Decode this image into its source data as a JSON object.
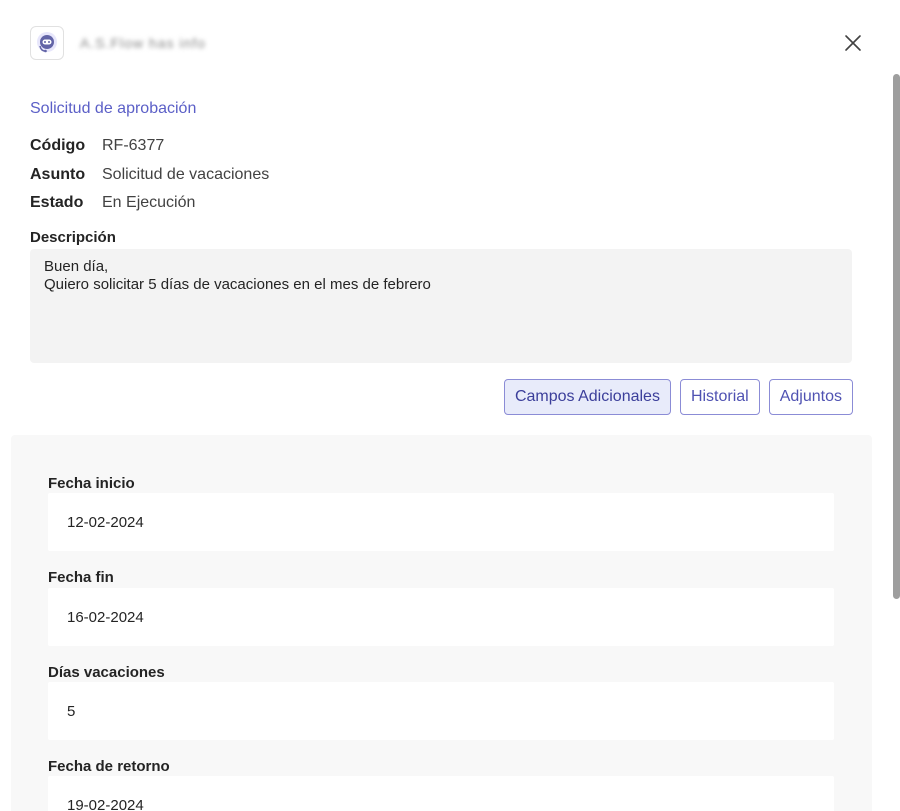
{
  "header": {
    "app_name": "A.S.Flow has info"
  },
  "request": {
    "title": "Solicitud de aprobación",
    "fields": [
      {
        "label": "Código",
        "value": "RF-6377"
      },
      {
        "label": "Asunto",
        "value": "Solicitud de vacaciones"
      },
      {
        "label": "Estado",
        "value": "En Ejecución"
      }
    ],
    "description_label": "Descripción",
    "description_lines": [
      "Buen día,",
      "Quiero solicitar 5 días de vacaciones en el mes de febrero"
    ]
  },
  "tabs": {
    "extra_fields": "Campos Adicionales",
    "history": "Historial",
    "attachments": "Adjuntos"
  },
  "additional_fields": [
    {
      "label": "Fecha inicio",
      "value": "12-02-2024"
    },
    {
      "label": "Fecha fin",
      "value": "16-02-2024"
    },
    {
      "label": "Días vacaciones",
      "value": "5"
    },
    {
      "label": "Fecha de retorno",
      "value": "19-02-2024"
    }
  ],
  "colors": {
    "accent": "#5b5fc7",
    "panel_bg": "#f8f8f8",
    "description_bg": "#f3f3f3"
  }
}
